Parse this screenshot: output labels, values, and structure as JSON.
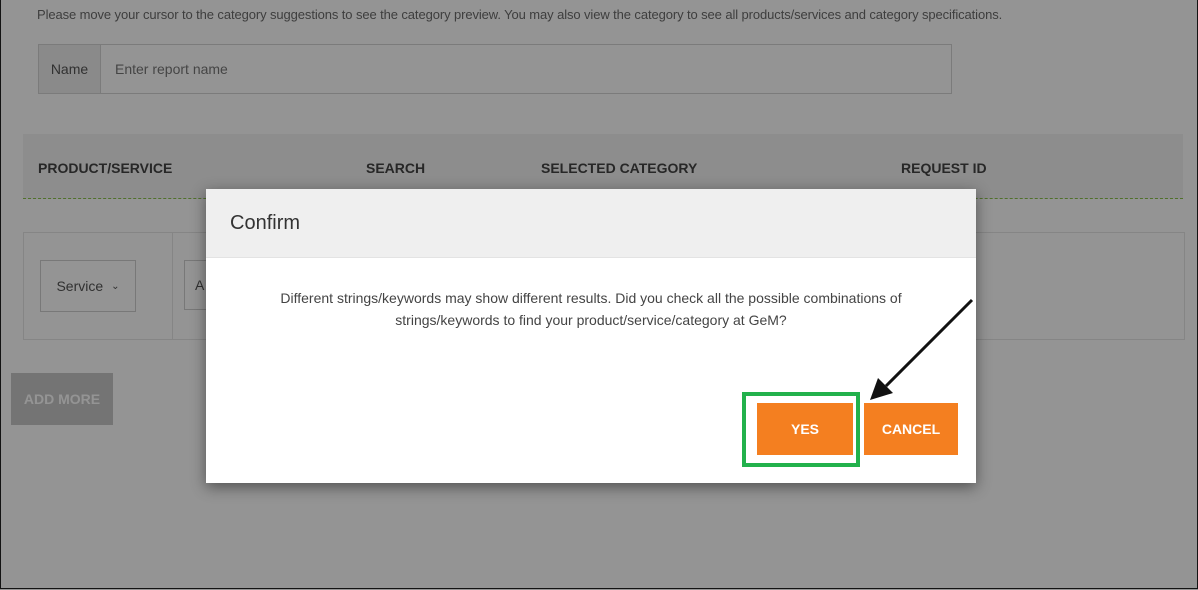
{
  "page": {
    "hint": "Please move your cursor to the category suggestions to see the category preview. You may also view the category to see all products/services and category specifications."
  },
  "form": {
    "name_label": "Name",
    "name_placeholder": "Enter report name"
  },
  "table": {
    "headers": [
      "PRODUCT/SERVICE",
      "SEARCH",
      "SELECTED CATEGORY",
      "REQUEST ID"
    ],
    "row": {
      "type_value": "Service",
      "search_partial": "A"
    }
  },
  "add_more_label": "ADD MORE",
  "modal": {
    "title": "Confirm",
    "message_line1": "Different strings/keywords may show different results. Did you check all the possible combinations of",
    "message_line2": "strings/keywords to find your product/service/category at GeM?",
    "yes_label": "YES",
    "cancel_label": "CANCEL"
  },
  "colors": {
    "accent": "#f47f20",
    "highlight": "#22b14c",
    "header_divider": "#8bc34a"
  }
}
